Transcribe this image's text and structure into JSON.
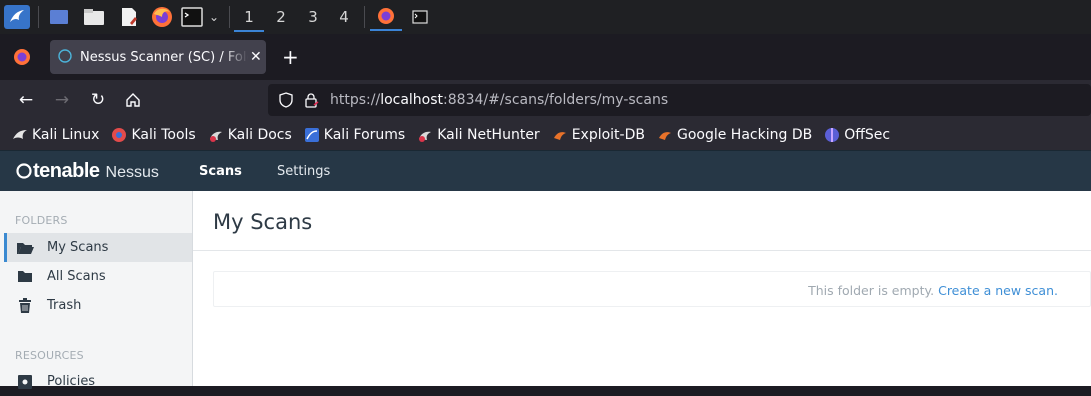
{
  "taskbar": {
    "workspaces": [
      "1",
      "2",
      "3",
      "4"
    ],
    "active_workspace": "1",
    "icons": [
      "kali-menu-icon",
      "desktop-icon",
      "file-manager-icon",
      "text-editor-icon",
      "firefox-icon",
      "terminal-icon",
      "chevron-down-icon",
      "firefox-window-icon",
      "terminal-window-icon"
    ]
  },
  "browser": {
    "tab": {
      "title": "Nessus Scanner (SC) / Folders / My Scans",
      "favicon": "nessus-loading-icon"
    },
    "new_tab_label": "+",
    "url": {
      "scheme": "https://",
      "host": "localhost",
      "rest": ":8834/#/scans/folders/my-scans"
    },
    "bookmarks": [
      {
        "label": "Kali Linux",
        "icon": "kali-dragon-icon"
      },
      {
        "label": "Kali Tools",
        "icon": "kali-tools-icon"
      },
      {
        "label": "Kali Docs",
        "icon": "kali-docs-icon"
      },
      {
        "label": "Kali Forums",
        "icon": "kali-forums-icon"
      },
      {
        "label": "Kali NetHunter",
        "icon": "kali-nethunter-icon"
      },
      {
        "label": "Exploit-DB",
        "icon": "exploit-db-icon"
      },
      {
        "label": "Google Hacking DB",
        "icon": "ghdb-icon"
      },
      {
        "label": "OffSec",
        "icon": "offsec-icon"
      }
    ]
  },
  "nessus": {
    "brand": {
      "company": "tenable",
      "product": "Nessus"
    },
    "nav": {
      "scans": "Scans",
      "settings": "Settings"
    },
    "sidebar": {
      "folders_heading": "FOLDERS",
      "folders": [
        {
          "label": "My Scans",
          "icon": "folder-open-icon",
          "active": true
        },
        {
          "label": "All Scans",
          "icon": "folder-icon",
          "active": false
        },
        {
          "label": "Trash",
          "icon": "trash-icon",
          "active": false
        }
      ],
      "resources_heading": "RESOURCES",
      "resources": [
        {
          "label": "Policies",
          "icon": "policies-icon"
        }
      ]
    },
    "main": {
      "title": "My Scans",
      "empty_text": "This folder is empty.",
      "create_link": "Create a new scan."
    }
  },
  "colors": {
    "nessus_header": "#263746",
    "accent_blue": "#3b8ad1",
    "link_blue": "#3f8fd6",
    "browser_chrome": "#2b2a33"
  }
}
